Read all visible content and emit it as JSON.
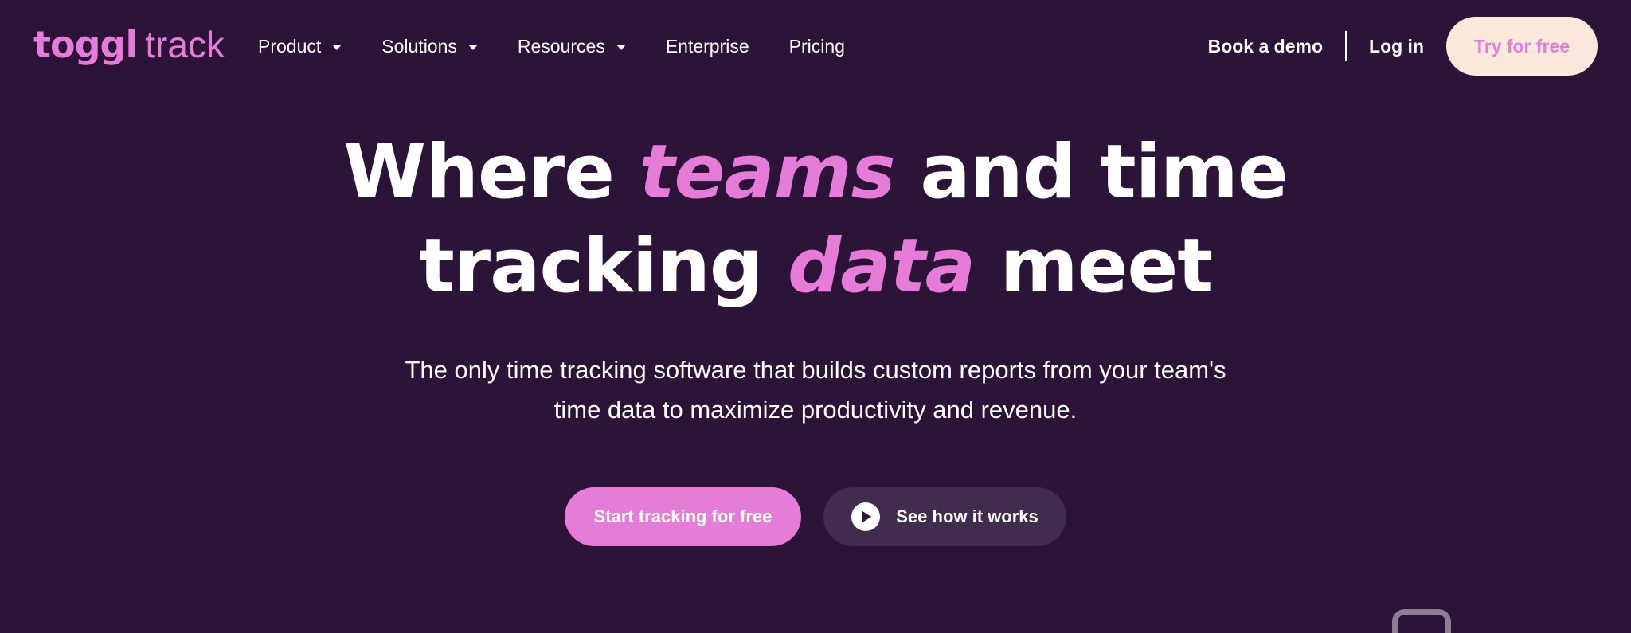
{
  "header": {
    "logo_primary": "toggl",
    "logo_secondary": "track",
    "nav": [
      {
        "label": "Product",
        "has_dropdown": true
      },
      {
        "label": "Solutions",
        "has_dropdown": true
      },
      {
        "label": "Resources",
        "has_dropdown": true
      },
      {
        "label": "Enterprise",
        "has_dropdown": false
      },
      {
        "label": "Pricing",
        "has_dropdown": false
      }
    ],
    "book_demo": "Book a demo",
    "login": "Log in",
    "try_free": "Try for free"
  },
  "hero": {
    "headline_line1_pre": "Where ",
    "headline_line1_hl": "teams",
    "headline_line1_post": " and time",
    "headline_line2_pre": "tracking ",
    "headline_line2_hl": "data",
    "headline_line2_post": " meet",
    "subtitle_line1": "The only time tracking software that builds custom reports from your team's",
    "subtitle_line2": "time data to maximize productivity and revenue.",
    "cta_primary": "Start tracking for free",
    "cta_secondary": "See how it works"
  },
  "colors": {
    "background": "#2c1338",
    "accent": "#e57cd8",
    "try_button_bg": "#fde9db",
    "secondary_button_bg": "#412c4d"
  },
  "icons": {
    "dropdown": "chevron-down-icon",
    "play": "play-icon"
  }
}
